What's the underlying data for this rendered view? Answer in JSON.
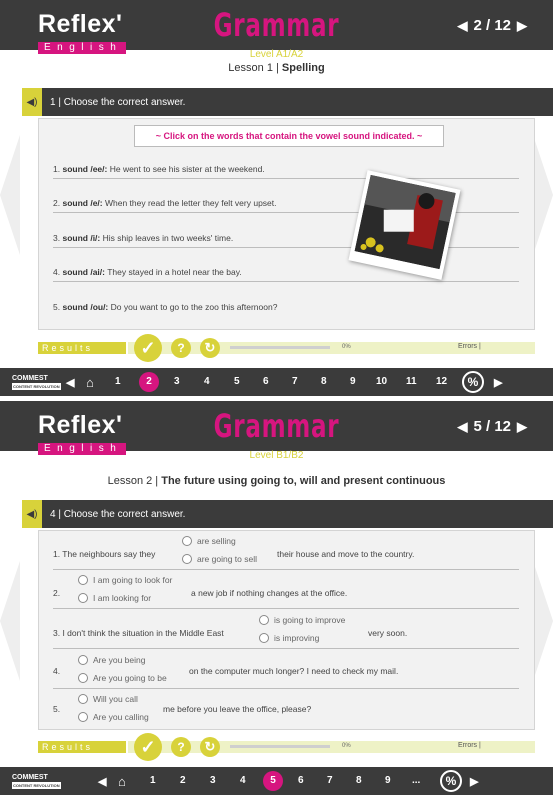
{
  "panel1": {
    "logo": {
      "word": "Reflex'",
      "sub": "English"
    },
    "title": "Grammar",
    "pager": {
      "prev": "◀",
      "text": "2 / 12",
      "next": "▶"
    },
    "level": "Level A1/A2",
    "lesson": {
      "prefix": "Lesson 1 |",
      "name": "Spelling"
    },
    "instruction": "1 | Choose the correct answer.",
    "hint": "~ Click on the words that contain the vowel sound indicated. ~",
    "sentences": [
      {
        "num": "1.",
        "label": "sound /ee/:",
        "text": "He went to see his sister at the weekend."
      },
      {
        "num": "2.",
        "label": "sound /e/:",
        "text": "When they read the letter they felt very upset."
      },
      {
        "num": "3.",
        "label": "sound /i/:",
        "text": "His ship leaves in two weeks' time."
      },
      {
        "num": "4.",
        "label": "sound /ai/:",
        "text": "They stayed in a hotel near the bay."
      },
      {
        "num": "5.",
        "label": "sound /ou/:",
        "text": "Do you want to go to the zoo this afternoon?"
      }
    ],
    "results": {
      "label": "Results",
      "pct": "0%",
      "errors": "Errors |",
      "progress": 0
    },
    "nav": {
      "brand": "COMMEST",
      "brand_sub": "CONTENT REVOLUTION",
      "pages": [
        "1",
        "2",
        "3",
        "4",
        "5",
        "6",
        "7",
        "8",
        "9",
        "10",
        "11",
        "12"
      ],
      "active": "2"
    }
  },
  "panel2": {
    "logo": {
      "word": "Reflex'",
      "sub": "English"
    },
    "title": "Grammar",
    "pager": {
      "prev": "◀",
      "text": "5 / 12",
      "next": "▶"
    },
    "level": "Level B1/B2",
    "lesson": {
      "prefix": "Lesson 2 |",
      "name": "The future using going to, will and present continuous"
    },
    "instruction": "4 | Choose the correct answer.",
    "questions": [
      {
        "lead": "1. The neighbours say they",
        "opt1": "are selling",
        "opt2": "are going to sell",
        "tail": "their house and move to the country."
      },
      {
        "lead": "2.",
        "opt1": "I am going to look for",
        "opt2": "I am looking for",
        "tail": "a new job if nothing changes at the office."
      },
      {
        "lead": "3. I don't think the situation in the Middle East",
        "opt1": "is going to improve",
        "opt2": "is improving",
        "tail": "very soon."
      },
      {
        "lead": "4.",
        "opt1": "Are you being",
        "opt2": "Are you going to be",
        "tail": "on the computer much longer? I need to check my mail."
      },
      {
        "lead": "5.",
        "opt1": "Will you call",
        "opt2": "Are you calling",
        "tail": "me before you leave the office, please?"
      }
    ],
    "results": {
      "label": "Results",
      "pct": "0%",
      "errors": "Errors |",
      "progress": 0
    },
    "nav": {
      "brand": "COMMEST",
      "brand_sub": "CONTENT REVOLUTION",
      "pages": [
        "1",
        "2",
        "3",
        "4",
        "5",
        "6",
        "7",
        "8",
        "9"
      ],
      "ellipsis": "...",
      "active": "5"
    }
  },
  "colors": {
    "dark": "#3b3b3b",
    "magenta": "#d6157f",
    "olive": "#d8d23a"
  },
  "icons": [
    "speaker-icon",
    "check-icon",
    "hint-icon",
    "reset-icon",
    "home-icon",
    "percent-icon",
    "arrow-left-icon",
    "arrow-right-icon"
  ]
}
